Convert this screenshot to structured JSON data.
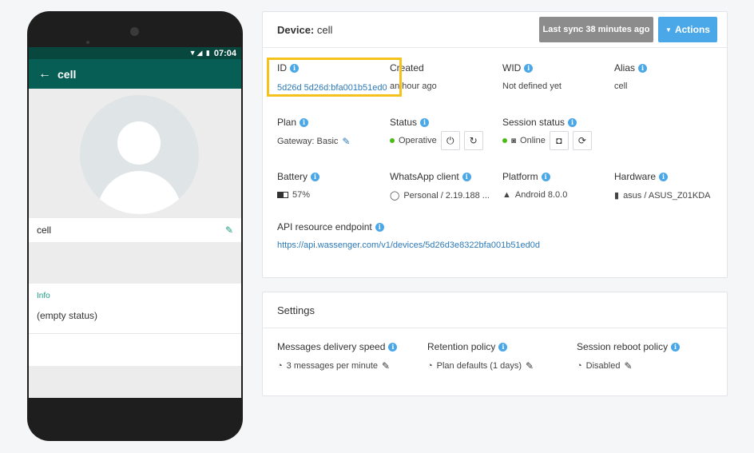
{
  "phone": {
    "status_time": "07:04",
    "status_icons": "▼◢ ▮",
    "back_icon": "←",
    "appbar_title": "cell",
    "profile_name": "cell",
    "info_title": "Info",
    "info_status": "(empty status)"
  },
  "device": {
    "title_label": "Device:",
    "title_value": "cell",
    "last_sync": "Last sync 38 minutes ago",
    "actions_label": "Actions",
    "id_label": "ID",
    "id_value": "5d26d 5d26d:bfa001b51ed0",
    "created_label": "Created",
    "created_value": "an hour ago",
    "wid_label": "WID",
    "wid_value": "Not defined yet",
    "alias_label": "Alias",
    "alias_value": "cell",
    "plan_label": "Plan",
    "plan_value": "Gateway: Basic",
    "status_label": "Status",
    "status_value": "Operative",
    "session_status_label": "Session status",
    "session_status_value": "Online",
    "battery_label": "Battery",
    "battery_value": "57%",
    "whatsapp_label": "WhatsApp client",
    "whatsapp_value": "Personal / 2.19.188 ...",
    "platform_label": "Platform",
    "platform_value": "Android 8.0.0",
    "hardware_label": "Hardware",
    "hardware_value": "asus / ASUS_Z01KDA",
    "api_label": "API resource endpoint",
    "api_value": "https://api.wassenger.com/v1/devices/5d26d3e8322bfa001b51ed0d"
  },
  "settings": {
    "title": "Settings",
    "delivery_label": "Messages delivery speed",
    "delivery_value": "3 messages per minute",
    "retention_label": "Retention policy",
    "retention_value": "Plan defaults (1 days)",
    "reboot_label": "Session reboot policy",
    "reboot_value": "Disabled"
  },
  "colors": {
    "whatsapp_dark": "#075e54",
    "accent_blue": "#4aa8e8",
    "online_green": "#4cbb17",
    "highlight": "#f5c21b"
  }
}
